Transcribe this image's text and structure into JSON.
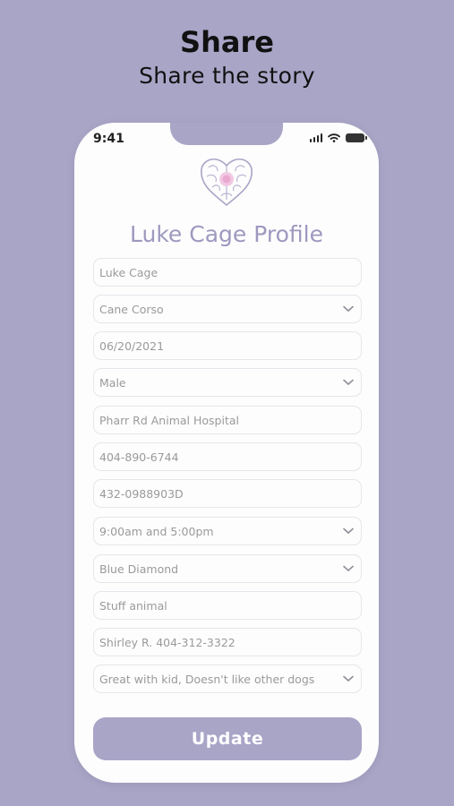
{
  "header": {
    "title": "Share",
    "subtitle": "Share the story"
  },
  "status_bar": {
    "time": "9:41",
    "icons": [
      "signal-icon",
      "wifi-icon",
      "battery-icon"
    ]
  },
  "form": {
    "title": "Luke Cage Profile",
    "fields": [
      {
        "value": "Luke Cage",
        "dropdown": false
      },
      {
        "value": "Cane Corso",
        "dropdown": true
      },
      {
        "value": "06/20/2021",
        "dropdown": false
      },
      {
        "value": "Male",
        "dropdown": true
      },
      {
        "value": "Pharr Rd Animal Hospital",
        "dropdown": false
      },
      {
        "value": "404-890-6744",
        "dropdown": false
      },
      {
        "value": "432-0988903D",
        "dropdown": false
      },
      {
        "value": "9:00am and 5:00pm",
        "dropdown": true
      },
      {
        "value": "Blue Diamond",
        "dropdown": true
      },
      {
        "value": "Stuff animal",
        "dropdown": false
      },
      {
        "value": "Shirley R. 404-312-3322",
        "dropdown": false
      },
      {
        "value": "Great with kid, Doesn't like other dogs",
        "dropdown": true
      }
    ],
    "update_label": "Update"
  },
  "colors": {
    "background": "#a9a5c7",
    "accent": "#9d99bf",
    "card": "#fdfdfd"
  }
}
